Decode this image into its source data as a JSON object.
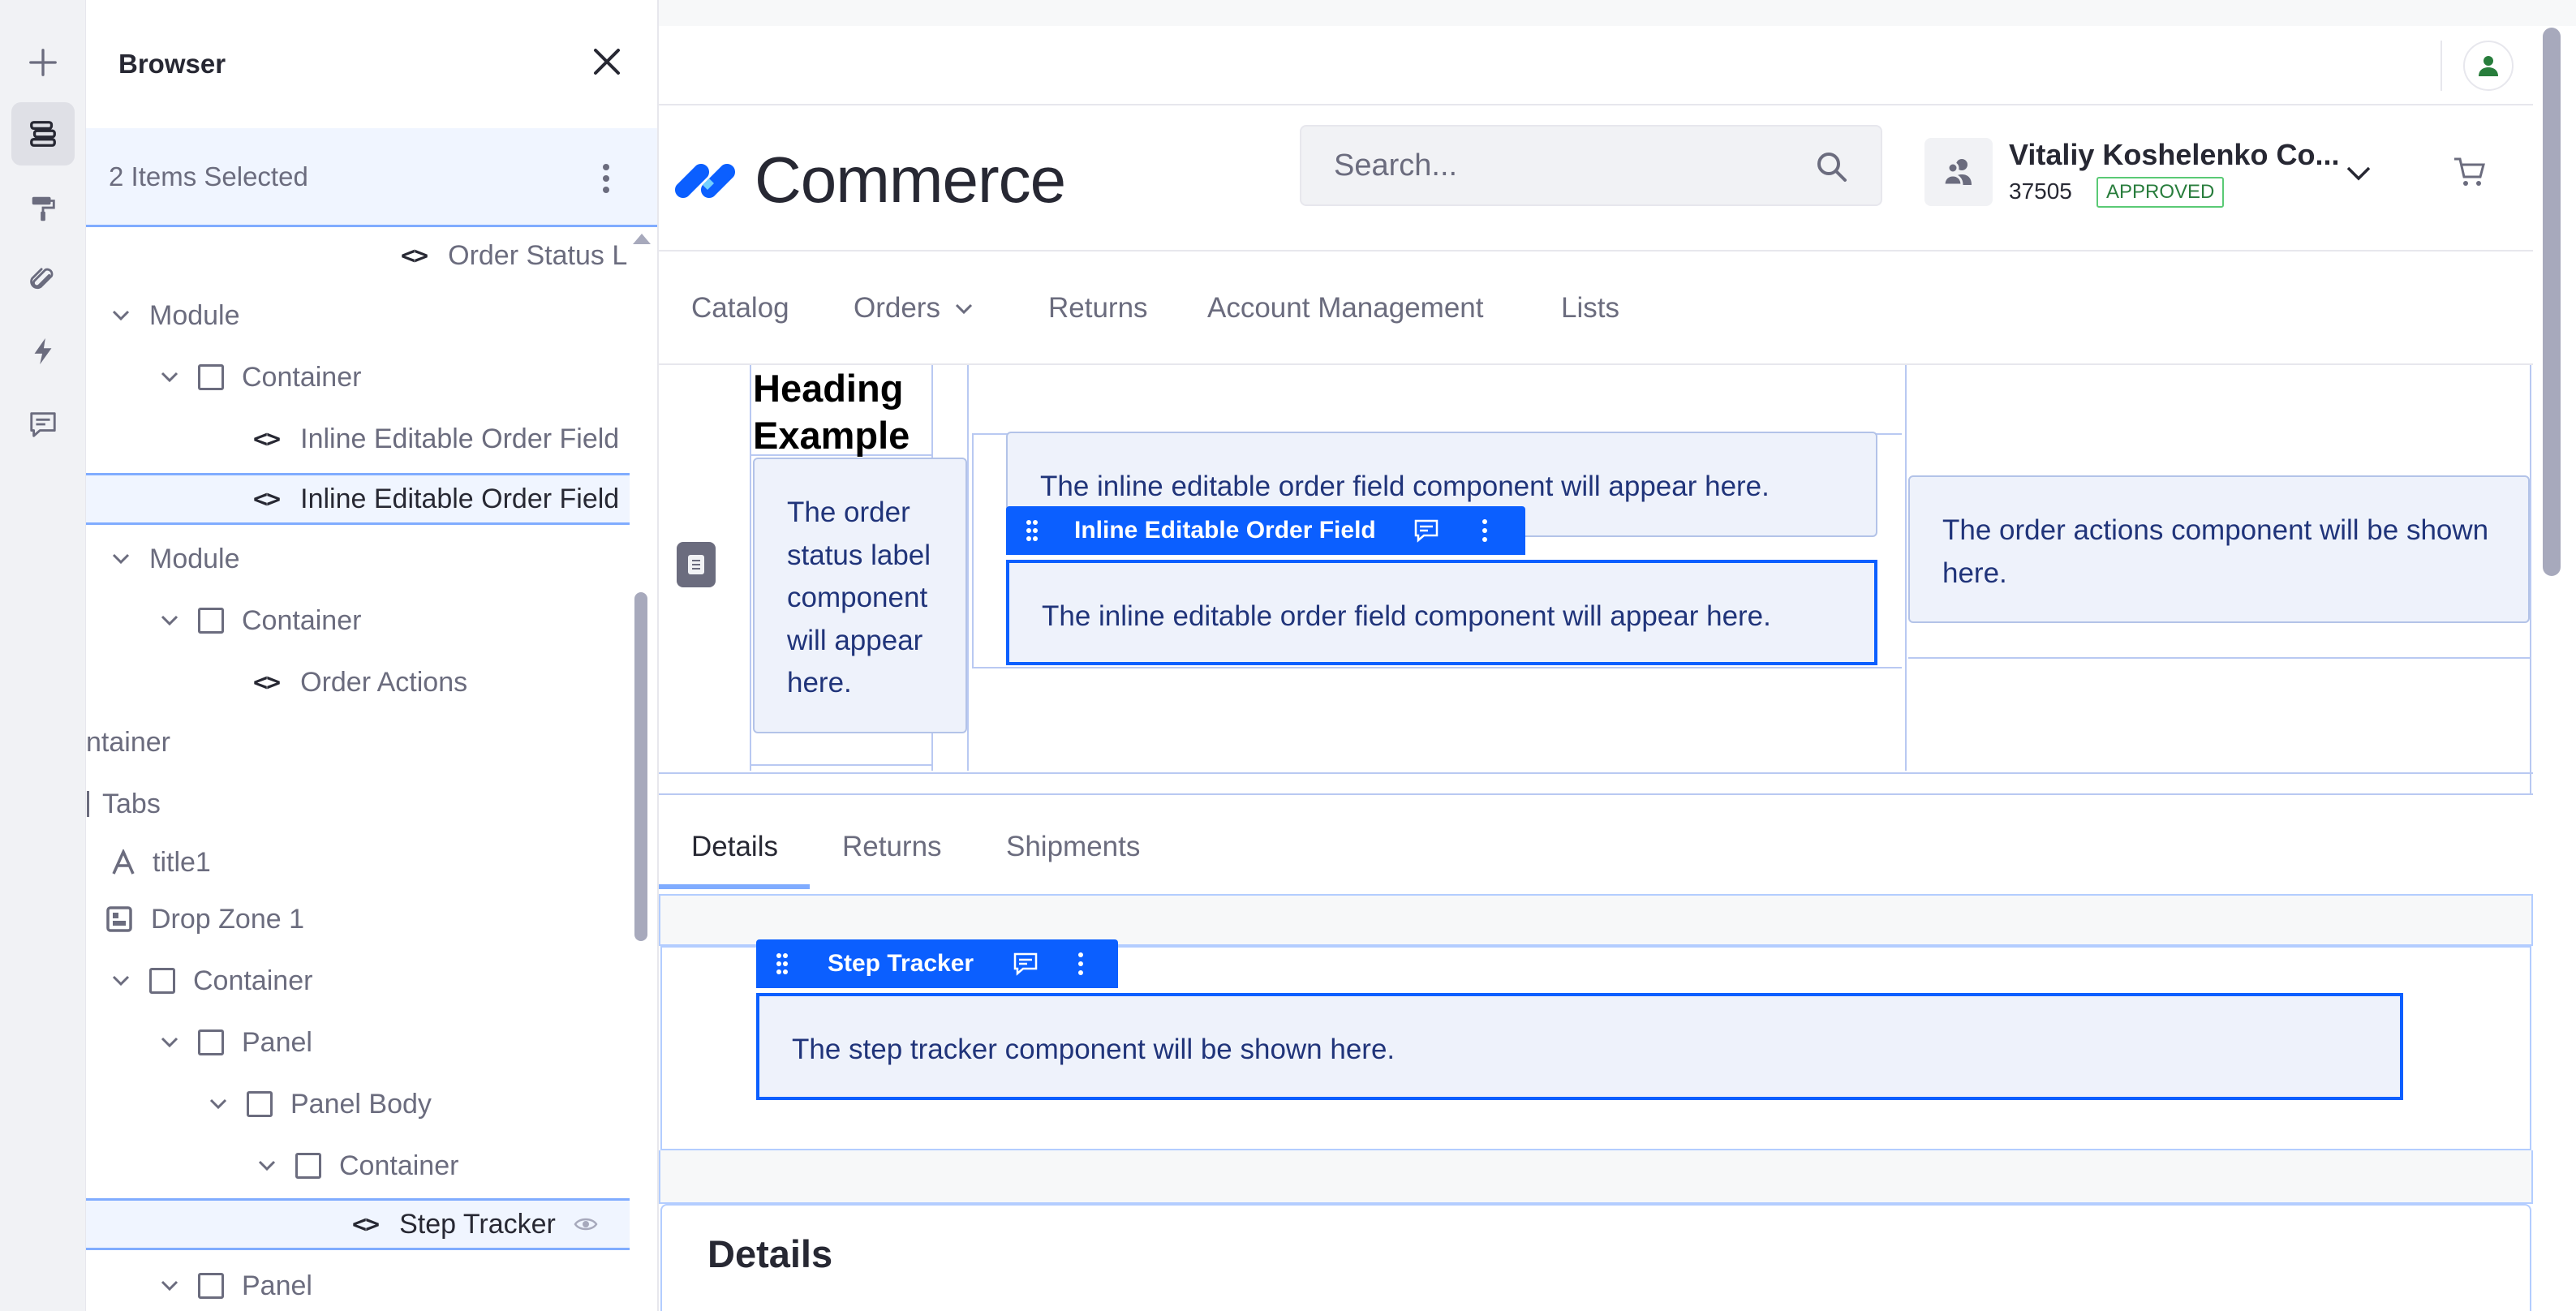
{
  "rail": {
    "items": [
      {
        "icon": "plus-icon"
      },
      {
        "icon": "browser-icon",
        "active": true
      },
      {
        "icon": "paint-roller-icon"
      },
      {
        "icon": "paperclip-icon"
      },
      {
        "icon": "bolt-icon"
      },
      {
        "icon": "comments-icon"
      }
    ]
  },
  "browser": {
    "title": "Browser",
    "selection_text": "2 Items Selected",
    "tree": [
      {
        "label": "Order Status L",
        "kind": "fragment"
      },
      {
        "label": "Module",
        "kind": "module"
      },
      {
        "label": "Container",
        "kind": "container"
      },
      {
        "label": "Inline Editable Order Field",
        "kind": "fragment"
      },
      {
        "label": "Inline Editable Order Field",
        "kind": "fragment",
        "selected": true
      },
      {
        "label": "Module",
        "kind": "module"
      },
      {
        "label": "Container",
        "kind": "container"
      },
      {
        "label": "Order Actions",
        "kind": "fragment"
      },
      {
        "label": "ntainer",
        "kind": "text"
      },
      {
        "label": "Tabs",
        "kind": "text"
      },
      {
        "label": "title1",
        "kind": "editable"
      },
      {
        "label": "Drop Zone 1",
        "kind": "dropzone"
      },
      {
        "label": "Container",
        "kind": "container"
      },
      {
        "label": "Panel",
        "kind": "container"
      },
      {
        "label": "Panel Body",
        "kind": "container"
      },
      {
        "label": "Container",
        "kind": "container"
      },
      {
        "label": "Step Tracker",
        "kind": "fragment",
        "selected": true
      },
      {
        "label": "Panel",
        "kind": "container"
      }
    ]
  },
  "header": {
    "logo_text": "Commerce",
    "search_placeholder": "Search...",
    "account_name": "Vitaliy Koshelenko Co...",
    "account_id": "37505",
    "account_status": "APPROVED"
  },
  "nav": {
    "items": [
      "Catalog",
      "Orders",
      "Returns",
      "Account Management",
      "Lists"
    ]
  },
  "content": {
    "heading": "Heading Example",
    "status_label_text": "The order status label component will appear here.",
    "inline_field_text_1": "The inline editable order field component will appear here.",
    "inline_field_toolbar": "Inline Editable Order Field",
    "inline_field_text_2": "The inline editable order field component will appear here.",
    "order_actions_text": "The order actions component will be shown here.",
    "tabs": [
      "Details",
      "Returns",
      "Shipments"
    ],
    "step_tracker_toolbar": "Step Tracker",
    "step_tracker_text": "The step tracker component will be shown here.",
    "details_title": "Details"
  },
  "colors": {
    "accent": "#0b5fff",
    "approved": "#287d3c",
    "fragment_bg": "#eef2fb"
  }
}
